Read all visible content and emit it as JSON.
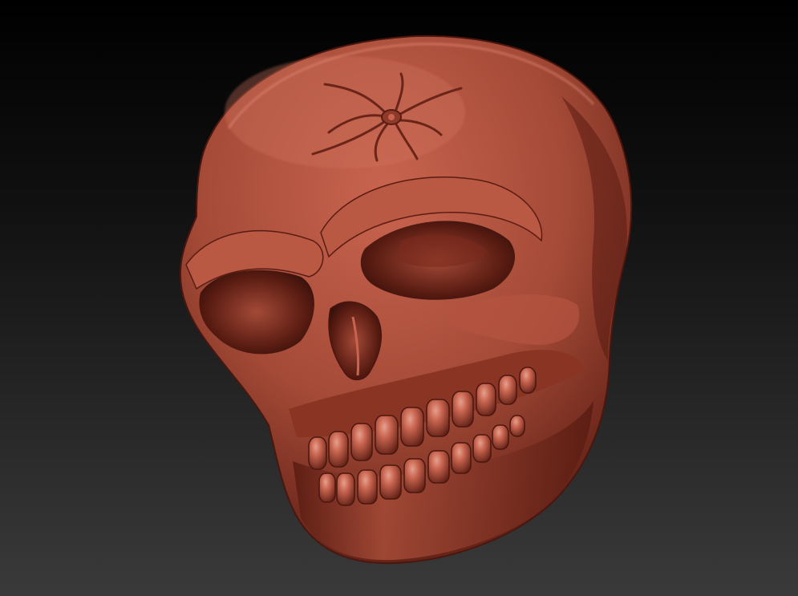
{
  "viewport": {
    "background_top": "#000000",
    "background_bottom": "#3a3a3a"
  },
  "model": {
    "subject": "sculpted-skull",
    "material_light": "#c8644f",
    "material_base": "#a44a37",
    "material_shadow": "#5a1c12",
    "material_deep": "#34100a",
    "highlight": "#e6a08f"
  },
  "forehead_emblem": {
    "subject": "spider-icon"
  }
}
